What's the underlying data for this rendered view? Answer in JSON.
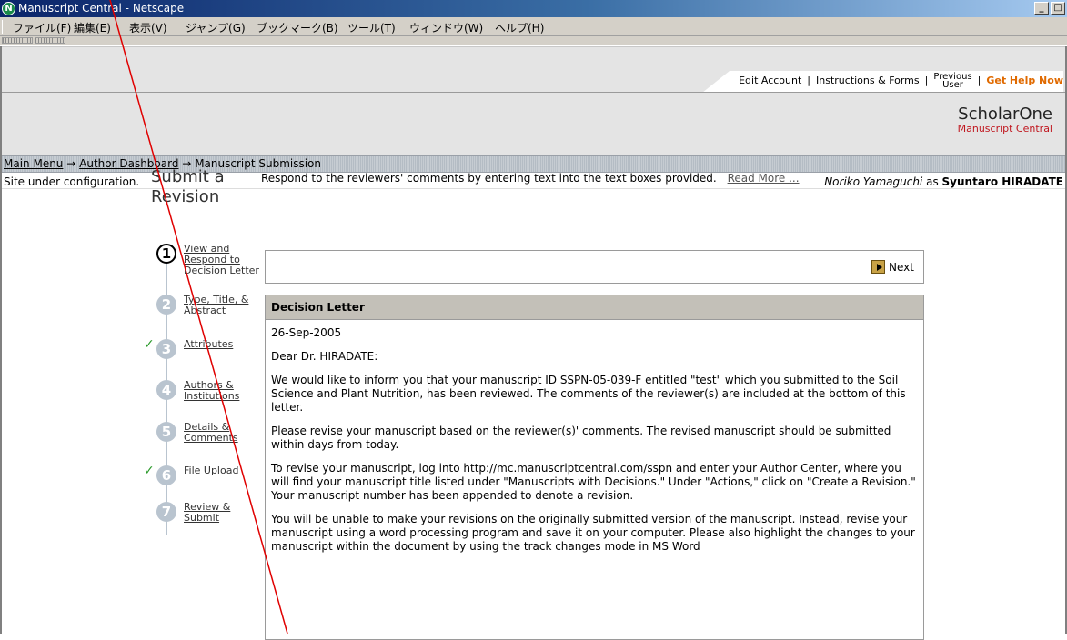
{
  "window": {
    "title": "Manuscript Central - Netscape",
    "app_icon_letter": "N",
    "controls": [
      "_",
      "□"
    ]
  },
  "menubar": {
    "items": [
      "ファイル(F)",
      "編集(E)",
      "表示(V)",
      "ジャンプ(G)",
      "ブックマーク(B)",
      "ツール(T)",
      "ウィンドウ(W)",
      "ヘルプ(H)"
    ]
  },
  "header": {
    "edit_account": "Edit Account",
    "instructions": "Instructions & Forms",
    "previous_line1": "Previous",
    "previous_line2": "User",
    "get_help": "Get Help Now",
    "separator": "|",
    "brand_main": "ScholarOne",
    "brand_sub": "Manuscript Central"
  },
  "breadcrumb": {
    "main_menu": "Main Menu",
    "arrow": "→",
    "author_dashboard": "Author Dashboard",
    "current": "Manuscript Submission"
  },
  "status": {
    "site_message": "Site under configuration.",
    "user_name": "Noriko Yamaguchi",
    "as_word": "as",
    "proxy_name": "Syuntaro HIRADATE"
  },
  "page": {
    "title": "Submit a Revision",
    "intro": "Respond to the reviewers' comments by entering text into the text boxes provided.",
    "read_more": "Read More ...",
    "next_label": "Next"
  },
  "steps": [
    {
      "num": "1",
      "label": "View and Respond to Decision Letter",
      "checked": false,
      "current": true
    },
    {
      "num": "2",
      "label": "Type, Title, & Abstract",
      "checked": false,
      "current": false
    },
    {
      "num": "3",
      "label": "Attributes",
      "checked": true,
      "current": false
    },
    {
      "num": "4",
      "label": "Authors & Institutions",
      "checked": false,
      "current": false
    },
    {
      "num": "5",
      "label": "Details & Comments",
      "checked": false,
      "current": false
    },
    {
      "num": "6",
      "label": "File Upload",
      "checked": true,
      "current": false
    },
    {
      "num": "7",
      "label": "Review & Submit",
      "checked": false,
      "current": false
    }
  ],
  "check_glyph": "✓",
  "letter": {
    "header": "Decision Letter",
    "paragraphs": [
      "26-Sep-2005",
      "Dear Dr. HIRADATE:",
      "We would like to inform you that your manuscript ID SSPN-05-039-F entitled \"test\" which you submitted to the Soil Science and Plant Nutrition, has been reviewed. The comments of the reviewer(s) are included at the bottom of this letter.",
      "Please revise your manuscript based on the reviewer(s)' comments. The revised manuscript should be submitted within days from today.",
      "To revise your manuscript, log into http://mc.manuscriptcentral.com/sspn and enter your Author Center, where you will find your manuscript title listed under \"Manuscripts with Decisions.\" Under \"Actions,\" click on \"Create a Revision.\" Your manuscript number has been appended to denote a revision.",
      "You will be unable to make your revisions on the originally submitted version of the manuscript. Instead, revise your manuscript using a word processing program and save it on your computer. Please also highlight the changes to your manuscript within the document by using the track changes mode in MS Word"
    ]
  },
  "colors": {
    "help_orange": "#e06a00",
    "brand_red": "#c0161e",
    "check_green": "#2a9a2a",
    "annotation_red": "#e00000"
  }
}
